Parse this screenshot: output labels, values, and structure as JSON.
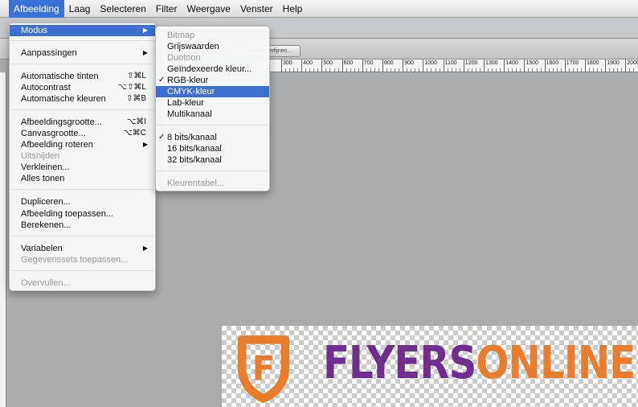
{
  "menubar": {
    "items": [
      "Afbeelding",
      "Laag",
      "Selecteren",
      "Filter",
      "Weergave",
      "Venster",
      "Help"
    ]
  },
  "toolbar": {
    "refine_label": "Randen verfijnen..."
  },
  "ruler": {
    "labels": [
      "300",
      "400",
      "500",
      "600",
      "700",
      "800",
      "900",
      "1000",
      "1100",
      "1200",
      "1300",
      "1400",
      "1500",
      "1600",
      "1700",
      "1800",
      "1900",
      "2000"
    ]
  },
  "main_menu": {
    "modus": "Modus",
    "aanpassingen": "Aanpassingen",
    "auto_tinten": "Automatische tinten",
    "auto_tinten_sc": "⇧⌘L",
    "autocontrast": "Autocontrast",
    "autocontrast_sc": "⌥⇧⌘L",
    "auto_kleuren": "Automatische kleuren",
    "auto_kleuren_sc": "⇧⌘B",
    "afb_grootte": "Afbeeldingsgrootte...",
    "afb_grootte_sc": "⌥⌘I",
    "canvas_grootte": "Canvasgrootte...",
    "canvas_grootte_sc": "⌥⌘C",
    "afb_roteren": "Afbeelding roteren",
    "uitsnijden": "Uitsnijden",
    "verkleinen": "Verkleinen...",
    "alles_tonen": "Alles tonen",
    "dupliceren": "Dupliceren...",
    "afb_toepassen": "Afbeelding toepassen...",
    "berekenen": "Berekenen...",
    "variabelen": "Variabelen",
    "gegevenssets": "Gegevenssets toepassen...",
    "overvullen": "Overvullen..."
  },
  "sub_menu": {
    "bitmap": "Bitmap",
    "grijswaarden": "Grijswaarden",
    "duotoon": "Duotoon",
    "geindexeerde": "Geïndexeerde kleur...",
    "rgb": "RGB-kleur",
    "cmyk": "CMYK-kleur",
    "lab": "Lab-kleur",
    "multikanaal": "Multikanaal",
    "bits8": "8 bits/kanaal",
    "bits16": "16 bits/kanaal",
    "bits32": "32 bits/kanaal",
    "kleurentabel": "Kleurentabel..."
  },
  "logo": {
    "mark_letter": "F",
    "text_part1": "FLYERS",
    "text_part2": "ONLINE"
  },
  "colors": {
    "highlight": "#3c6fcf",
    "menubar_active": "#3874d8",
    "logo_purple": "#6e2f8e",
    "logo_orange": "#e87d2e"
  }
}
